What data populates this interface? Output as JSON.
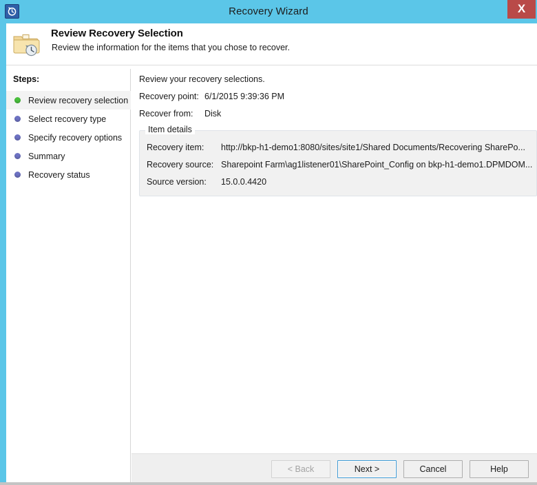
{
  "window": {
    "title": "Recovery Wizard",
    "app_icon": "recovery-clock-icon",
    "close_label": "X",
    "accent_color": "#5bc6e8",
    "close_color": "#b94a48"
  },
  "header": {
    "icon": "folder-history-icon",
    "title": "Review Recovery Selection",
    "subtitle": "Review the information for the items that you chose to recover."
  },
  "sidebar": {
    "heading": "Steps:",
    "items": [
      {
        "label": "Review recovery selection",
        "state": "done",
        "bullet_color": "#49bf3c",
        "active": true
      },
      {
        "label": "Select recovery type",
        "state": "pending",
        "bullet_color": "#6d72c3",
        "active": false
      },
      {
        "label": "Specify recovery options",
        "state": "pending",
        "bullet_color": "#6d72c3",
        "active": false
      },
      {
        "label": "Summary",
        "state": "pending",
        "bullet_color": "#6d72c3",
        "active": false
      },
      {
        "label": "Recovery status",
        "state": "pending",
        "bullet_color": "#6d72c3",
        "active": false
      }
    ]
  },
  "content": {
    "intro": "Review your recovery selections.",
    "recovery_point_label": "Recovery point:",
    "recovery_point_value": "6/1/2015 9:39:36 PM",
    "recover_from_label": "Recover from:",
    "recover_from_value": "Disk",
    "item_details": {
      "legend": "Item details",
      "recovery_item_label": "Recovery item:",
      "recovery_item_value": "http://bkp-h1-demo1:8080/sites/site1/Shared Documents/Recovering SharePo...",
      "recovery_source_label": "Recovery source:",
      "recovery_source_value": "Sharepoint Farm\\ag1listener01\\SharePoint_Config on bkp-h1-demo1.DPMDOM...",
      "source_version_label": "Source version:",
      "source_version_value": "15.0.0.4420"
    }
  },
  "footer": {
    "buttons": [
      {
        "label": "< Back",
        "state": "disabled"
      },
      {
        "label": "Next >",
        "state": "default"
      },
      {
        "label": "Cancel",
        "state": "normal"
      },
      {
        "label": "Help",
        "state": "normal"
      }
    ]
  }
}
